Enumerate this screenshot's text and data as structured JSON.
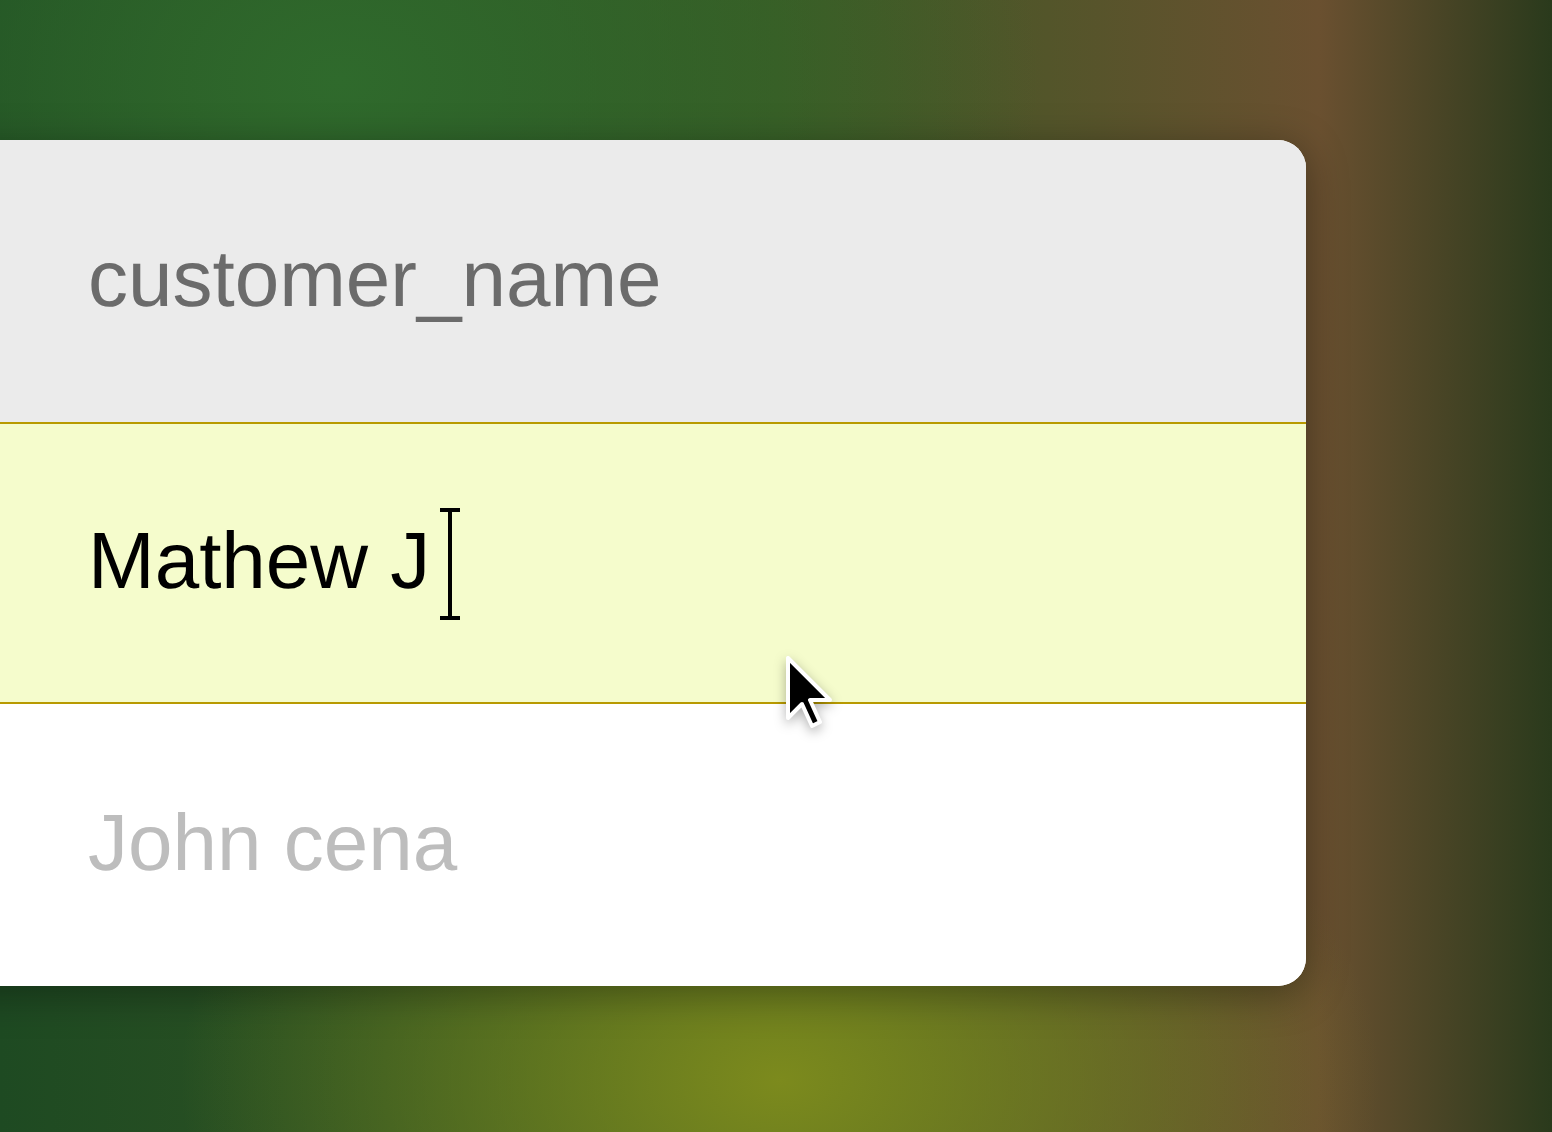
{
  "column": {
    "header": "customer_name"
  },
  "rows": [
    {
      "value": "Mathew J",
      "editing": true
    },
    {
      "value": "John cena",
      "editing": false
    }
  ]
}
